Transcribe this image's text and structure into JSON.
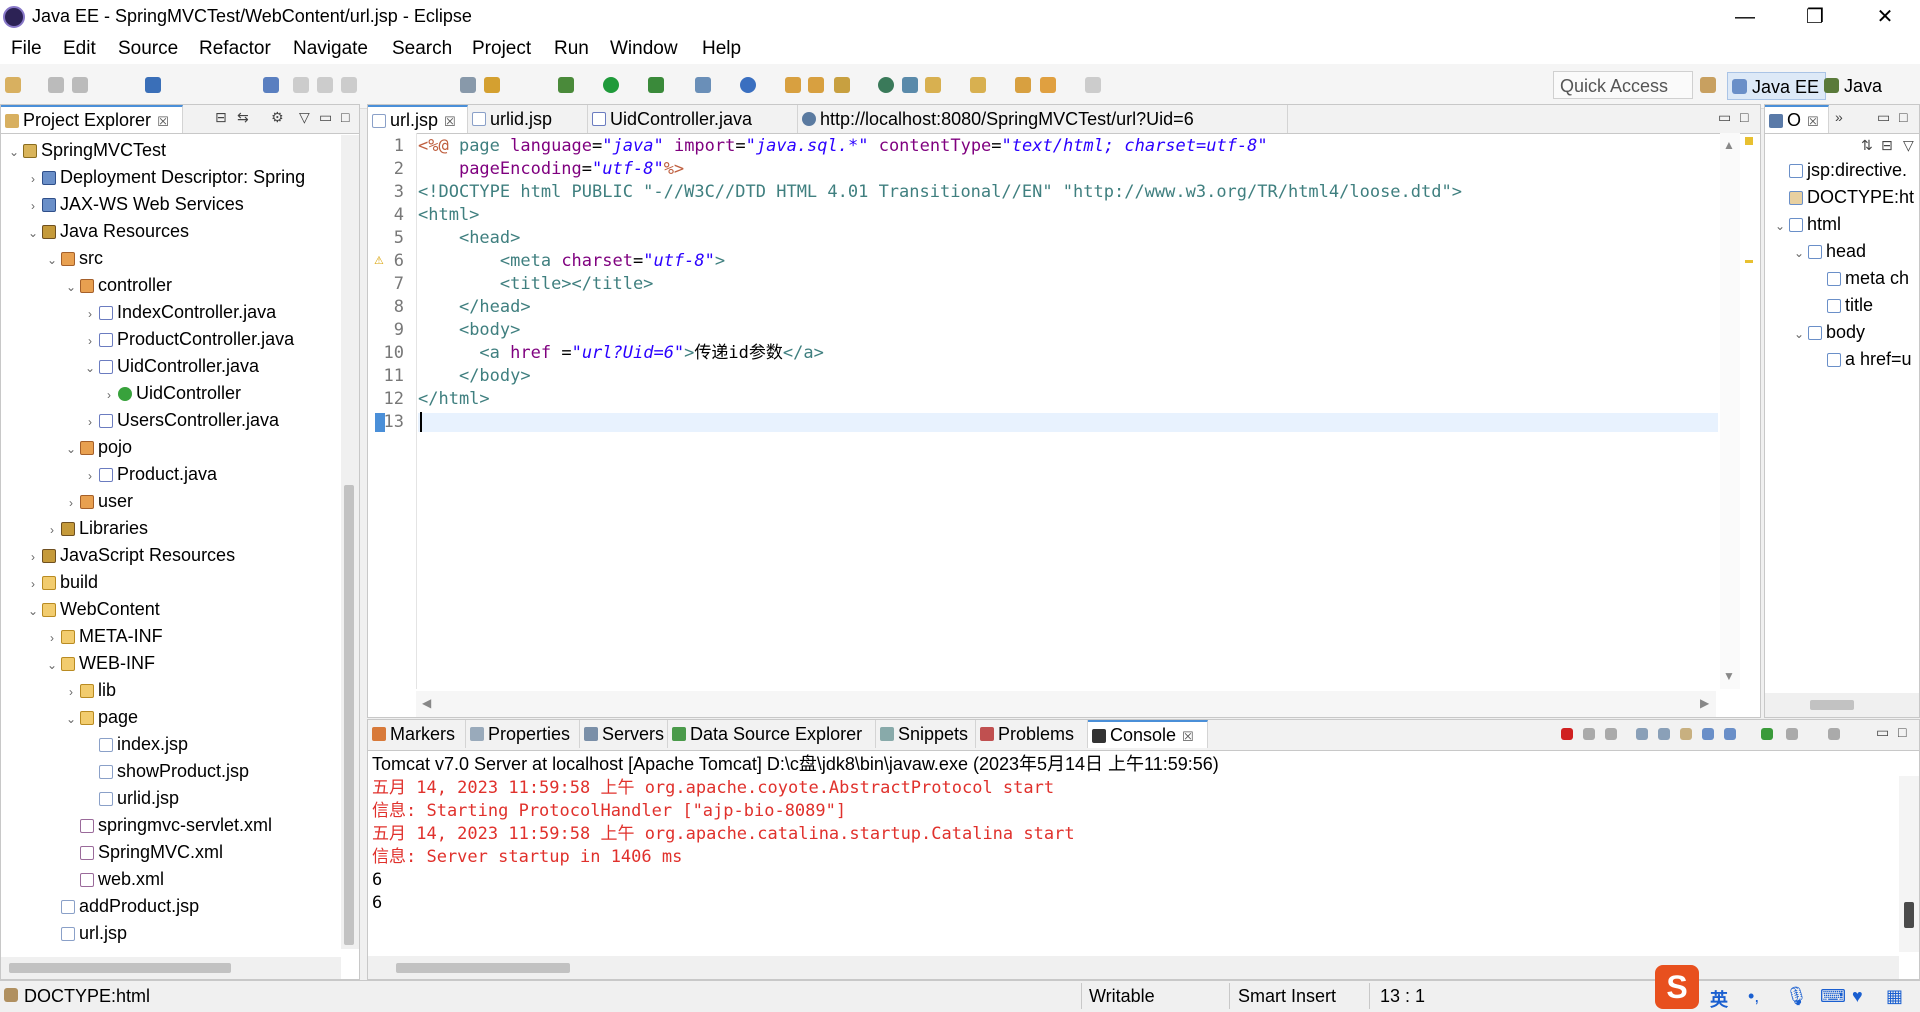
{
  "window": {
    "title": "Java EE - SpringMVCTest/WebContent/url.jsp - Eclipse"
  },
  "menu": [
    "File",
    "Edit",
    "Source",
    "Refactor",
    "Navigate",
    "Search",
    "Project",
    "Run",
    "Window",
    "Help"
  ],
  "toolbar": {
    "quick_access": "Quick Access",
    "perspectives": [
      "Java EE",
      "Java"
    ]
  },
  "project_explorer": {
    "tab": "Project Explorer",
    "items": [
      {
        "label": "SpringMVCTest",
        "depth": 0,
        "twisty": "v",
        "icon": "project-icon"
      },
      {
        "label": "Deployment Descriptor: Spring",
        "depth": 1,
        "twisty": ">",
        "icon": "descriptor-icon"
      },
      {
        "label": "JAX-WS Web Services",
        "depth": 1,
        "twisty": ">",
        "icon": "webservice-icon"
      },
      {
        "label": "Java Resources",
        "depth": 1,
        "twisty": "v",
        "icon": "java-resources-icon"
      },
      {
        "label": "src",
        "depth": 2,
        "twisty": "v",
        "icon": "source-folder-icon"
      },
      {
        "label": "controller",
        "depth": 3,
        "twisty": "v",
        "icon": "package-icon"
      },
      {
        "label": "IndexController.java",
        "depth": 4,
        "twisty": ">",
        "icon": "java-file-icon"
      },
      {
        "label": "ProductController.java",
        "depth": 4,
        "twisty": ">",
        "icon": "java-file-icon"
      },
      {
        "label": "UidController.java",
        "depth": 4,
        "twisty": "v",
        "icon": "java-file-icon"
      },
      {
        "label": "UidController",
        "depth": 5,
        "twisty": ">",
        "icon": "class-icon"
      },
      {
        "label": "UsersController.java",
        "depth": 4,
        "twisty": ">",
        "icon": "java-file-icon"
      },
      {
        "label": "pojo",
        "depth": 3,
        "twisty": "v",
        "icon": "package-icon"
      },
      {
        "label": "Product.java",
        "depth": 4,
        "twisty": ">",
        "icon": "java-file-icon"
      },
      {
        "label": "user",
        "depth": 3,
        "twisty": ">",
        "icon": "package-icon"
      },
      {
        "label": "Libraries",
        "depth": 2,
        "twisty": ">",
        "icon": "libraries-icon"
      },
      {
        "label": "JavaScript Resources",
        "depth": 1,
        "twisty": ">",
        "icon": "javascript-resources-icon"
      },
      {
        "label": "build",
        "depth": 1,
        "twisty": ">",
        "icon": "folder-icon"
      },
      {
        "label": "WebContent",
        "depth": 1,
        "twisty": "v",
        "icon": "folder-icon"
      },
      {
        "label": "META-INF",
        "depth": 2,
        "twisty": ">",
        "icon": "folder-icon"
      },
      {
        "label": "WEB-INF",
        "depth": 2,
        "twisty": "v",
        "icon": "folder-icon"
      },
      {
        "label": "lib",
        "depth": 3,
        "twisty": ">",
        "icon": "folder-icon"
      },
      {
        "label": "page",
        "depth": 3,
        "twisty": "v",
        "icon": "folder-icon"
      },
      {
        "label": "index.jsp",
        "depth": 4,
        "twisty": "",
        "icon": "jsp-file-icon"
      },
      {
        "label": "showProduct.jsp",
        "depth": 4,
        "twisty": "",
        "icon": "jsp-file-icon"
      },
      {
        "label": "urlid.jsp",
        "depth": 4,
        "twisty": "",
        "icon": "jsp-file-icon"
      },
      {
        "label": "springmvc-servlet.xml",
        "depth": 3,
        "twisty": "",
        "icon": "xml-file-icon"
      },
      {
        "label": "SpringMVC.xml",
        "depth": 3,
        "twisty": "",
        "icon": "xml-file-icon"
      },
      {
        "label": "web.xml",
        "depth": 3,
        "twisty": "",
        "icon": "xml-file-icon"
      },
      {
        "label": "addProduct.jsp",
        "depth": 2,
        "twisty": "",
        "icon": "jsp-file-icon"
      },
      {
        "label": "url.jsp",
        "depth": 2,
        "twisty": "",
        "icon": "jsp-file-icon"
      }
    ]
  },
  "editor": {
    "tabs": [
      {
        "label": "url.jsp",
        "active": true,
        "close": "☒"
      },
      {
        "label": "urlid.jsp",
        "active": false,
        "close": ""
      },
      {
        "label": "UidController.java",
        "active": false,
        "close": ""
      },
      {
        "label": "http://localhost:8080/SpringMVCTest/url?Uid=6",
        "active": false,
        "close": ""
      }
    ],
    "lines": [
      {
        "n": "1",
        "segs": [
          [
            "k-dir",
            "<%@ "
          ],
          [
            "k-tag",
            "page "
          ],
          [
            "k-attr",
            "language"
          ],
          [
            "k-txt",
            "="
          ],
          [
            "k-str",
            "\"java\""
          ],
          [
            "k-txt",
            " "
          ],
          [
            "k-attr",
            "import"
          ],
          [
            "k-txt",
            "="
          ],
          [
            "k-str",
            "\"java.sql.*\""
          ],
          [
            "k-txt",
            " "
          ],
          [
            "k-attr",
            "contentType"
          ],
          [
            "k-txt",
            "="
          ],
          [
            "k-str",
            "\"text/html; charset=utf-8\""
          ]
        ]
      },
      {
        "n": "2",
        "segs": [
          [
            "k-txt",
            "    "
          ],
          [
            "k-attr",
            "pageEncoding"
          ],
          [
            "k-txt",
            "="
          ],
          [
            "k-str",
            "\"utf-8\""
          ],
          [
            "k-dir",
            "%>"
          ]
        ]
      },
      {
        "n": "3",
        "segs": [
          [
            "k-dt",
            "<!DOCTYPE html PUBLIC \"-//W3C//DTD HTML 4.01 Transitional//EN\" \"http://www.w3.org/TR/html4/loose.dtd\">"
          ]
        ]
      },
      {
        "n": "4",
        "segs": [
          [
            "k-tag",
            "<html>"
          ]
        ]
      },
      {
        "n": "5",
        "segs": [
          [
            "k-txt",
            "    "
          ],
          [
            "k-tag",
            "<head>"
          ]
        ]
      },
      {
        "n": "6",
        "segs": [
          [
            "k-txt",
            "        "
          ],
          [
            "k-tag",
            "<meta "
          ],
          [
            "k-attr",
            "charset"
          ],
          [
            "k-txt",
            "="
          ],
          [
            "k-str",
            "\"utf-8\""
          ],
          [
            "k-tag",
            ">"
          ]
        ]
      },
      {
        "n": "7",
        "segs": [
          [
            "k-txt",
            "        "
          ],
          [
            "k-tag",
            "<title></title>"
          ]
        ]
      },
      {
        "n": "8",
        "segs": [
          [
            "k-txt",
            "    "
          ],
          [
            "k-tag",
            "</head>"
          ]
        ]
      },
      {
        "n": "9",
        "segs": [
          [
            "k-txt",
            "    "
          ],
          [
            "k-tag",
            "<body>"
          ]
        ]
      },
      {
        "n": "10",
        "segs": [
          [
            "k-txt",
            "      "
          ],
          [
            "k-tag",
            "<a "
          ],
          [
            "k-attr",
            "href"
          ],
          [
            "k-txt",
            " ="
          ],
          [
            "k-str",
            "\"url?Uid=6\""
          ],
          [
            "k-tag",
            ">"
          ],
          [
            "k-txt",
            "传递id参数"
          ],
          [
            "k-tag",
            "</a>"
          ]
        ]
      },
      {
        "n": "11",
        "segs": [
          [
            "k-txt",
            "    "
          ],
          [
            "k-tag",
            "</body>"
          ]
        ]
      },
      {
        "n": "12",
        "segs": [
          [
            "k-tag",
            "</html>"
          ]
        ]
      },
      {
        "n": "13",
        "segs": []
      }
    ]
  },
  "outline": {
    "tab": "O",
    "items": [
      {
        "label": "jsp:directive.",
        "depth": 0,
        "twisty": "",
        "icon": "directive-icon"
      },
      {
        "label": "DOCTYPE:ht",
        "depth": 0,
        "twisty": "",
        "icon": "doctype-icon"
      },
      {
        "label": "html",
        "depth": 0,
        "twisty": "v",
        "icon": "element-icon"
      },
      {
        "label": "head",
        "depth": 1,
        "twisty": "v",
        "icon": "element-icon"
      },
      {
        "label": "meta ch",
        "depth": 2,
        "twisty": "",
        "icon": "element-icon"
      },
      {
        "label": "title",
        "depth": 2,
        "twisty": "",
        "icon": "element-icon"
      },
      {
        "label": "body",
        "depth": 1,
        "twisty": "v",
        "icon": "element-icon"
      },
      {
        "label": "a href=u",
        "depth": 2,
        "twisty": "",
        "icon": "anchor-icon"
      }
    ]
  },
  "bottom": {
    "tabs": [
      "Markers",
      "Properties",
      "Servers",
      "Data Source Explorer",
      "Snippets",
      "Problems",
      "Console"
    ],
    "console_header": "Tomcat v7.0 Server at localhost [Apache Tomcat] D:\\c盘\\jdk8\\bin\\javaw.exe (2023年5月14日 上午11:59:56)",
    "console_lines": [
      {
        "text": "五月 14, 2023 11:59:58 上午 org.apache.coyote.AbstractProtocol start",
        "red": true
      },
      {
        "text": "信息: Starting ProtocolHandler [\"ajp-bio-8089\"]",
        "red": true
      },
      {
        "text": "五月 14, 2023 11:59:58 上午 org.apache.catalina.startup.Catalina start",
        "red": true
      },
      {
        "text": "信息: Server startup in 1406 ms",
        "red": true
      },
      {
        "text": "6",
        "red": false
      },
      {
        "text": "6",
        "red": false
      }
    ]
  },
  "status": {
    "left": "DOCTYPE:html",
    "writable": "Writable",
    "insert": "Smart Insert",
    "position": "13 : 1",
    "ime_label": "英"
  },
  "colors": {
    "accent": "#4a8fd8",
    "console_error": "#e0312c",
    "current_line": "#e8f2fe"
  }
}
